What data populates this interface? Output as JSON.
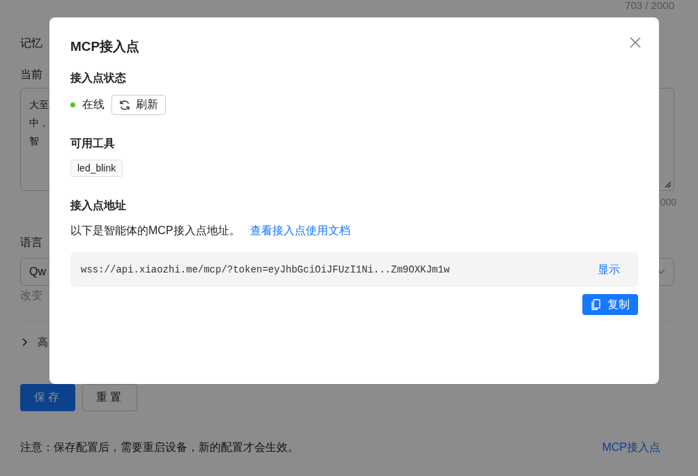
{
  "page": {
    "top_counter": "703 / 2000",
    "memory_label": "记忆",
    "current_label": "当前",
    "memory_text_lines": [
      "大至",
      "中，",
      "智"
    ],
    "memory_counter": "000",
    "model_label": "语言",
    "model_select_value": "Qw",
    "model_hint": "改变",
    "advanced_label": "高",
    "buttons": [
      {
        "label": "保存",
        "kind": "primary"
      },
      {
        "label": "重置",
        "kind": "default"
      }
    ],
    "note": "注意：保存配置后，需要重启设备，新的配置才会生效。",
    "mcp_link": "MCP接入点"
  },
  "dialog": {
    "title": "MCP接入点",
    "status_title": "接入点状态",
    "status": {
      "text": "在线",
      "online": true
    },
    "refresh_button": "刷新",
    "tools_title": "可用工具",
    "tools": [
      "led_blink"
    ],
    "address_title": "接入点地址",
    "description": "以下是智能体的MCP接入点地址。",
    "doc_link": "查看接入点使用文档",
    "url": "wss://api.xiaozhi.me/mcp/?token=eyJhbGciOiJFUzI1Ni...Zm9OXKJm1w",
    "show_button": "显示",
    "copy_button": "复制"
  }
}
